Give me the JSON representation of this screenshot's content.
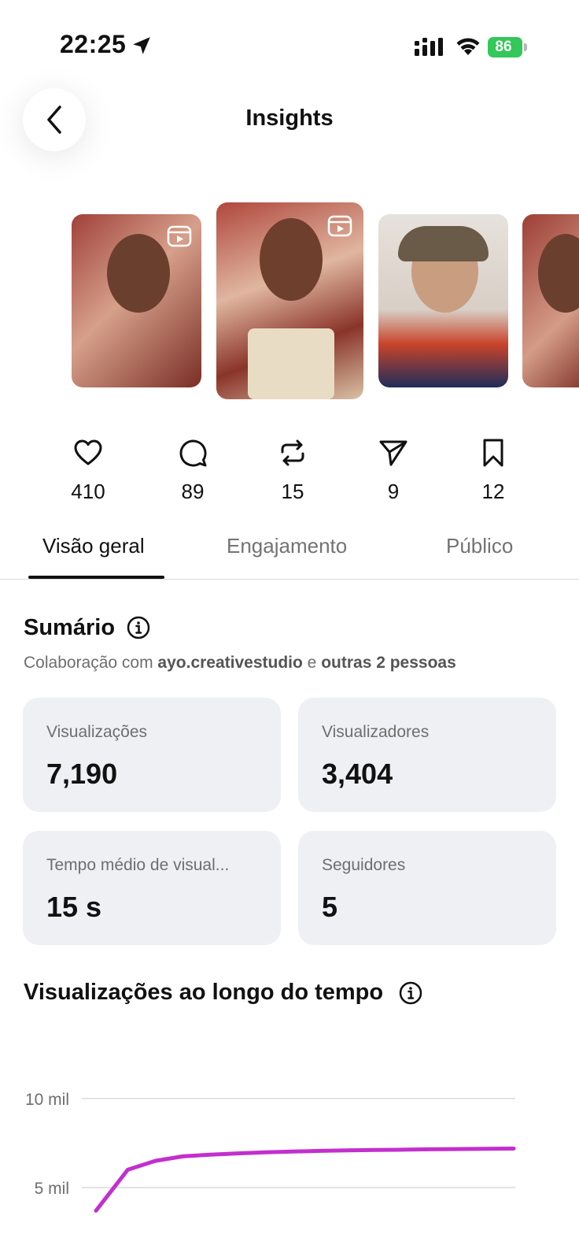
{
  "status": {
    "time": "22:25",
    "battery": "86"
  },
  "header": {
    "title": "Insights"
  },
  "stats": [
    {
      "icon": "heart-icon",
      "value": "410"
    },
    {
      "icon": "comment-icon",
      "value": "89"
    },
    {
      "icon": "repost-icon",
      "value": "15"
    },
    {
      "icon": "share-icon",
      "value": "9"
    },
    {
      "icon": "bookmark-icon",
      "value": "12"
    }
  ],
  "tabs": [
    {
      "label": "Visão geral",
      "active": true
    },
    {
      "label": "Engajamento",
      "active": false
    },
    {
      "label": "Público",
      "active": false
    }
  ],
  "summary": {
    "title": "Sumário",
    "collab_prefix": "Colaboração com ",
    "collab_user": "ayo.creativestudio",
    "collab_and": " e ",
    "collab_others": "outras 2 pessoas",
    "cards": [
      {
        "label": "Visualizações",
        "value": "7,190"
      },
      {
        "label": "Visualizadores",
        "value": "3,404"
      },
      {
        "label": "Tempo médio de visual...",
        "value": "15 s"
      },
      {
        "label": "Seguidores",
        "value": "5"
      }
    ]
  },
  "chart_section": {
    "title": "Visualizações ao longo do tempo"
  },
  "chart_data": {
    "type": "line",
    "title": "Visualizações ao longo do tempo",
    "y_ticks": [
      "10 mil",
      "5 mil"
    ],
    "ylim": [
      0,
      10000
    ],
    "grid": true,
    "series": [
      {
        "color": "#c32fce",
        "values": [
          3700,
          6000,
          6500,
          6750,
          6850,
          6920,
          6980,
          7020,
          7060,
          7090,
          7110,
          7130,
          7150,
          7165,
          7180,
          7190
        ]
      }
    ]
  },
  "colors": {
    "accent_line": "#c32fce",
    "card_bg": "#eff0f4",
    "battery_green": "#34c759"
  }
}
